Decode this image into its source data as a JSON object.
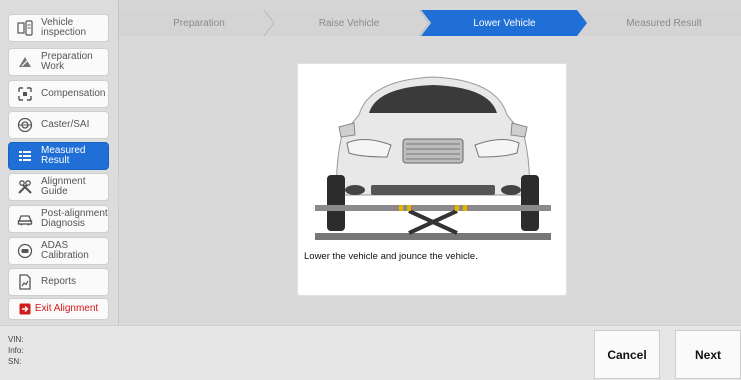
{
  "sidebar": {
    "items": [
      {
        "label": "Vehicle\ninspection",
        "icon": "vehicle-inspection-icon"
      },
      {
        "label": "Preparation\nWork",
        "icon": "preparation-icon"
      },
      {
        "label": "Compensation",
        "icon": "compensation-icon"
      },
      {
        "label": "Caster/SAI",
        "icon": "caster-icon"
      },
      {
        "label": "Measured\nResult",
        "icon": "measured-result-icon",
        "active": true
      },
      {
        "label": "Alignment\nGuide",
        "icon": "wrench-icon"
      },
      {
        "label": "Post-alignment\nDiagnosis",
        "icon": "car-diagnosis-icon"
      },
      {
        "label": "ADAS\nCalibration",
        "icon": "adas-icon"
      },
      {
        "label": "Reports",
        "icon": "report-icon"
      }
    ],
    "exit_label": "Exit Alignment"
  },
  "steps": [
    {
      "label": "Preparation",
      "active": false
    },
    {
      "label": "Raise Vehicle",
      "active": false
    },
    {
      "label": "Lower Vehicle",
      "active": true
    },
    {
      "label": "Measured Result",
      "active": false
    }
  ],
  "instruction": {
    "caption": "Lower the vehicle and jounce the vehicle."
  },
  "footer": {
    "vin_label": "VIN:",
    "info_label": "Info:",
    "sn_label": "SN:",
    "cancel_label": "Cancel",
    "next_label": "Next"
  },
  "colors": {
    "accent": "#1f6fd6",
    "exit": "#d21a1a"
  }
}
